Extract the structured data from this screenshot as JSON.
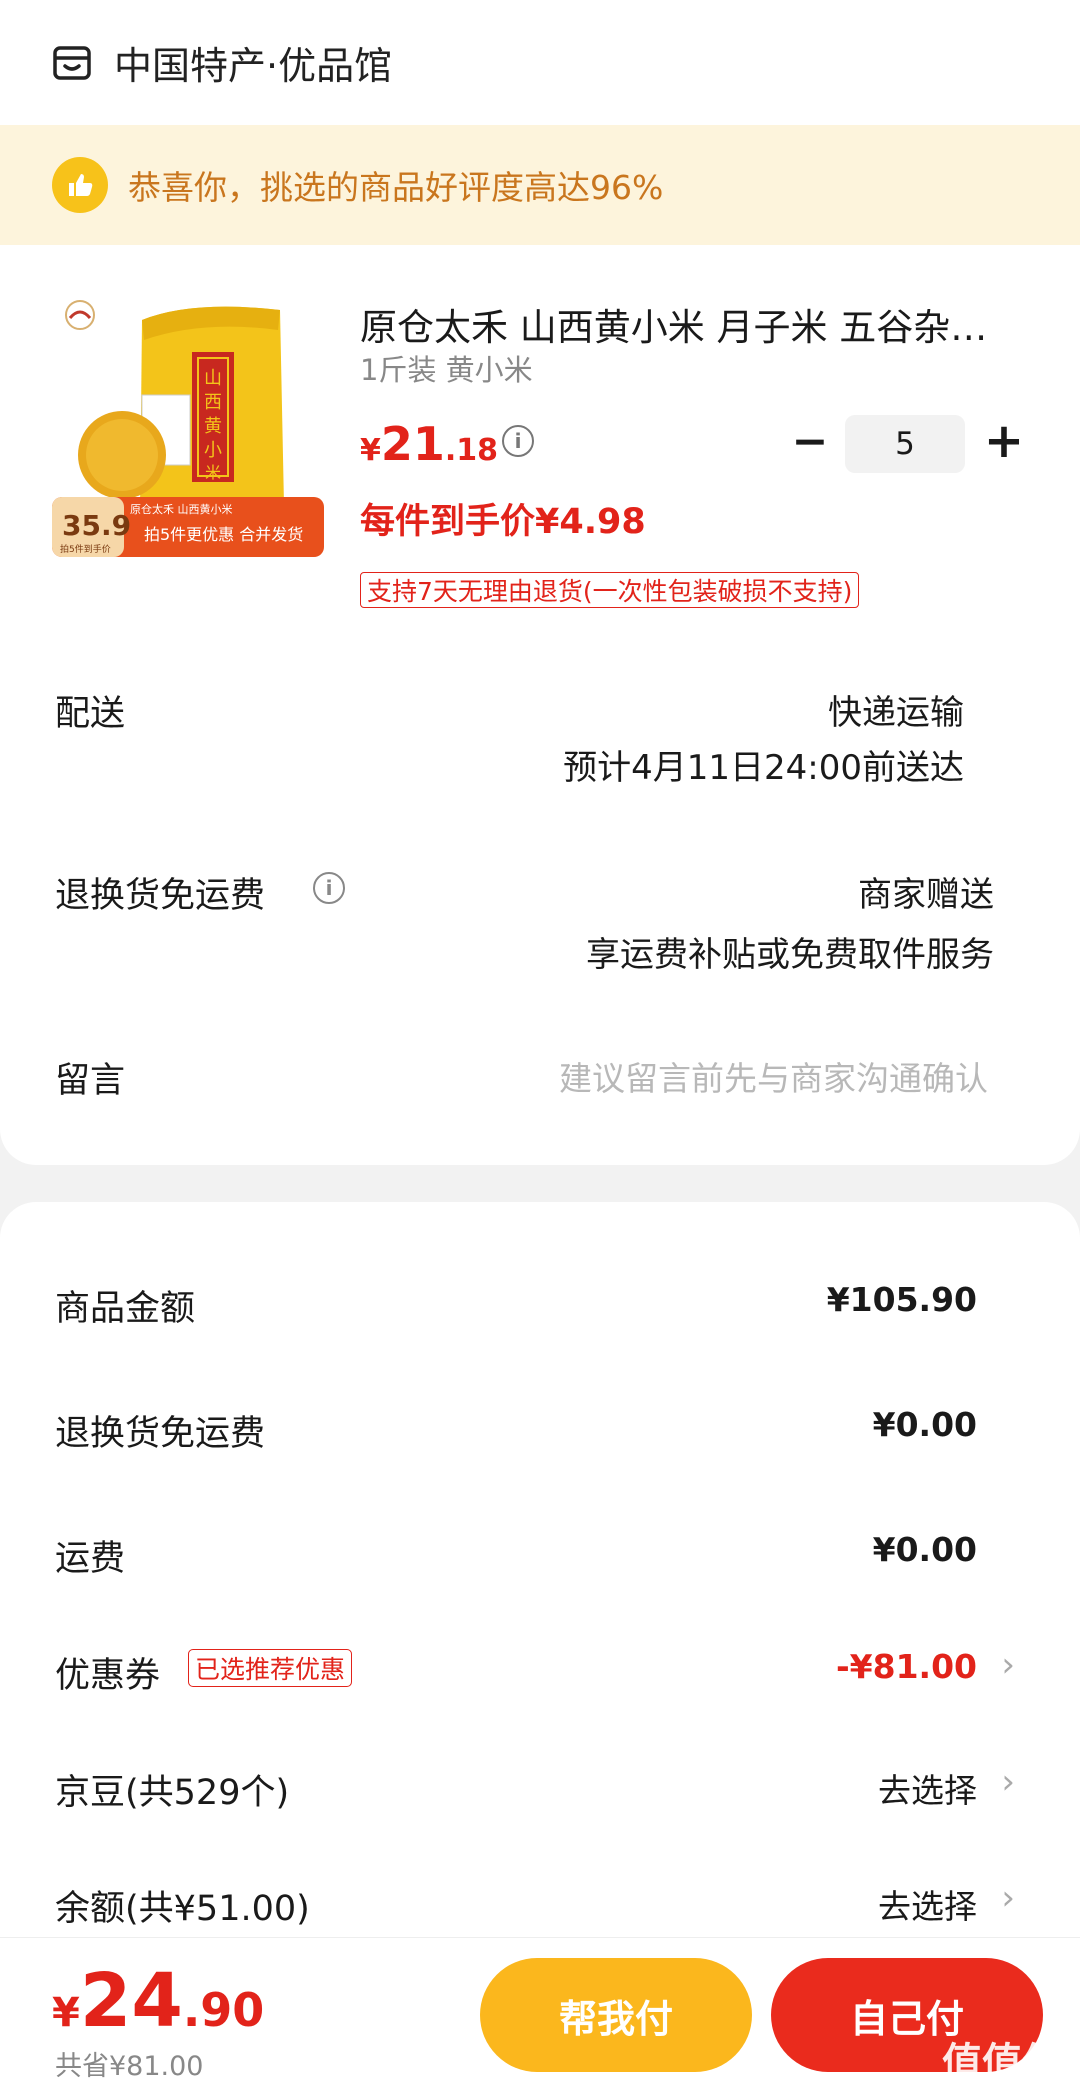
{
  "store": {
    "name": "中国特产·优品馆",
    "icon": "shop-icon"
  },
  "banner": {
    "text": "恭喜你，挑选的商品好评度高达96%",
    "icon": "thumbs-up-icon"
  },
  "product": {
    "title": "原仓太禾 山西黄小米 月子米 五谷杂粮 小米粥",
    "spec": "1斤装 黄小米",
    "price_symbol": "¥",
    "price_int": "21",
    "price_dec": ".18",
    "quantity": "5",
    "unit_price": "每件到手价¥4.98",
    "return_tag": "支持7天无理由退货(一次性包装破损不支持)",
    "image": {
      "bag_text": "山西黄小米",
      "badge_price": "35.9",
      "badge_note": "拍5件到手价",
      "banner_text": "拍5件更优惠 合并发货",
      "label_text": "原仓太禾 山西黄小米"
    }
  },
  "delivery": {
    "label": "配送",
    "method": "快递运输",
    "eta": "预计4月11日24:00前送达"
  },
  "return_shipping": {
    "label": "退换货免运费",
    "value": "商家赠送",
    "desc": "享运费补贴或免费取件服务"
  },
  "remark": {
    "label": "留言",
    "placeholder": "建议留言前先与商家沟通确认"
  },
  "summary": {
    "goods_amount": {
      "label": "商品金额",
      "value": "¥105.90"
    },
    "return_fee": {
      "label": "退换货免运费",
      "value": "¥0.00"
    },
    "shipping": {
      "label": "运费",
      "value": "¥0.00"
    },
    "coupon": {
      "label": "优惠券",
      "tag": "已选推荐优惠",
      "value": "-¥81.00"
    },
    "jingdou": {
      "label": "京豆(共529个)",
      "action": "去选择"
    },
    "balance": {
      "label": "余额(共¥51.00)",
      "action": "去选择"
    }
  },
  "bottom": {
    "total_symbol": "¥",
    "total_int": "24",
    "total_dec": ".90",
    "saved": "共省¥81.00",
    "help_pay": "帮我付",
    "self_pay": "自己付",
    "watermark": "值值值"
  },
  "colors": {
    "accent": "#e2231a",
    "help_button": "#fbb71d",
    "banner_bg": "#fdf4dc",
    "banner_text": "#c9761e"
  }
}
